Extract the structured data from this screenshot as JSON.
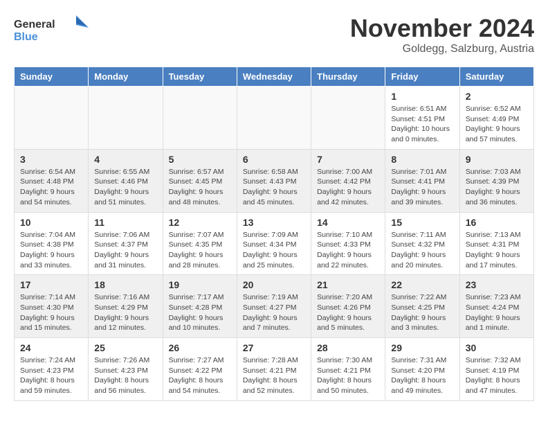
{
  "header": {
    "logo_line1": "General",
    "logo_line2": "Blue",
    "month": "November 2024",
    "location": "Goldegg, Salzburg, Austria"
  },
  "days_of_week": [
    "Sunday",
    "Monday",
    "Tuesday",
    "Wednesday",
    "Thursday",
    "Friday",
    "Saturday"
  ],
  "weeks": [
    [
      {
        "day": "",
        "info": ""
      },
      {
        "day": "",
        "info": ""
      },
      {
        "day": "",
        "info": ""
      },
      {
        "day": "",
        "info": ""
      },
      {
        "day": "",
        "info": ""
      },
      {
        "day": "1",
        "info": "Sunrise: 6:51 AM\nSunset: 4:51 PM\nDaylight: 10 hours\nand 0 minutes."
      },
      {
        "day": "2",
        "info": "Sunrise: 6:52 AM\nSunset: 4:49 PM\nDaylight: 9 hours\nand 57 minutes."
      }
    ],
    [
      {
        "day": "3",
        "info": "Sunrise: 6:54 AM\nSunset: 4:48 PM\nDaylight: 9 hours\nand 54 minutes."
      },
      {
        "day": "4",
        "info": "Sunrise: 6:55 AM\nSunset: 4:46 PM\nDaylight: 9 hours\nand 51 minutes."
      },
      {
        "day": "5",
        "info": "Sunrise: 6:57 AM\nSunset: 4:45 PM\nDaylight: 9 hours\nand 48 minutes."
      },
      {
        "day": "6",
        "info": "Sunrise: 6:58 AM\nSunset: 4:43 PM\nDaylight: 9 hours\nand 45 minutes."
      },
      {
        "day": "7",
        "info": "Sunrise: 7:00 AM\nSunset: 4:42 PM\nDaylight: 9 hours\nand 42 minutes."
      },
      {
        "day": "8",
        "info": "Sunrise: 7:01 AM\nSunset: 4:41 PM\nDaylight: 9 hours\nand 39 minutes."
      },
      {
        "day": "9",
        "info": "Sunrise: 7:03 AM\nSunset: 4:39 PM\nDaylight: 9 hours\nand 36 minutes."
      }
    ],
    [
      {
        "day": "10",
        "info": "Sunrise: 7:04 AM\nSunset: 4:38 PM\nDaylight: 9 hours\nand 33 minutes."
      },
      {
        "day": "11",
        "info": "Sunrise: 7:06 AM\nSunset: 4:37 PM\nDaylight: 9 hours\nand 31 minutes."
      },
      {
        "day": "12",
        "info": "Sunrise: 7:07 AM\nSunset: 4:35 PM\nDaylight: 9 hours\nand 28 minutes."
      },
      {
        "day": "13",
        "info": "Sunrise: 7:09 AM\nSunset: 4:34 PM\nDaylight: 9 hours\nand 25 minutes."
      },
      {
        "day": "14",
        "info": "Sunrise: 7:10 AM\nSunset: 4:33 PM\nDaylight: 9 hours\nand 22 minutes."
      },
      {
        "day": "15",
        "info": "Sunrise: 7:11 AM\nSunset: 4:32 PM\nDaylight: 9 hours\nand 20 minutes."
      },
      {
        "day": "16",
        "info": "Sunrise: 7:13 AM\nSunset: 4:31 PM\nDaylight: 9 hours\nand 17 minutes."
      }
    ],
    [
      {
        "day": "17",
        "info": "Sunrise: 7:14 AM\nSunset: 4:30 PM\nDaylight: 9 hours\nand 15 minutes."
      },
      {
        "day": "18",
        "info": "Sunrise: 7:16 AM\nSunset: 4:29 PM\nDaylight: 9 hours\nand 12 minutes."
      },
      {
        "day": "19",
        "info": "Sunrise: 7:17 AM\nSunset: 4:28 PM\nDaylight: 9 hours\nand 10 minutes."
      },
      {
        "day": "20",
        "info": "Sunrise: 7:19 AM\nSunset: 4:27 PM\nDaylight: 9 hours\nand 7 minutes."
      },
      {
        "day": "21",
        "info": "Sunrise: 7:20 AM\nSunset: 4:26 PM\nDaylight: 9 hours\nand 5 minutes."
      },
      {
        "day": "22",
        "info": "Sunrise: 7:22 AM\nSunset: 4:25 PM\nDaylight: 9 hours\nand 3 minutes."
      },
      {
        "day": "23",
        "info": "Sunrise: 7:23 AM\nSunset: 4:24 PM\nDaylight: 9 hours\nand 1 minute."
      }
    ],
    [
      {
        "day": "24",
        "info": "Sunrise: 7:24 AM\nSunset: 4:23 PM\nDaylight: 8 hours\nand 59 minutes."
      },
      {
        "day": "25",
        "info": "Sunrise: 7:26 AM\nSunset: 4:23 PM\nDaylight: 8 hours\nand 56 minutes."
      },
      {
        "day": "26",
        "info": "Sunrise: 7:27 AM\nSunset: 4:22 PM\nDaylight: 8 hours\nand 54 minutes."
      },
      {
        "day": "27",
        "info": "Sunrise: 7:28 AM\nSunset: 4:21 PM\nDaylight: 8 hours\nand 52 minutes."
      },
      {
        "day": "28",
        "info": "Sunrise: 7:30 AM\nSunset: 4:21 PM\nDaylight: 8 hours\nand 50 minutes."
      },
      {
        "day": "29",
        "info": "Sunrise: 7:31 AM\nSunset: 4:20 PM\nDaylight: 8 hours\nand 49 minutes."
      },
      {
        "day": "30",
        "info": "Sunrise: 7:32 AM\nSunset: 4:19 PM\nDaylight: 8 hours\nand 47 minutes."
      }
    ]
  ]
}
